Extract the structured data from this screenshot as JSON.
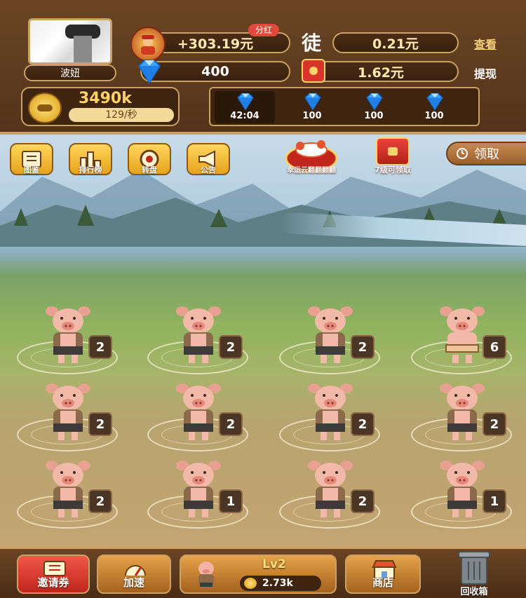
{
  "header": {
    "username": "波妞",
    "earnings": "+303.19元",
    "share_badge": "分红",
    "apprentice_label": "徒",
    "apprentice_amount": "0.21元",
    "view_link": "查看",
    "diamond_count": "400",
    "redpacket_amount": "1.62元",
    "withdraw_link": "提现",
    "coins": "3490k",
    "coin_rate": "129/秒",
    "diamond_slots": [
      {
        "label": "42:04"
      },
      {
        "label": "100"
      },
      {
        "label": "100"
      },
      {
        "label": "100"
      }
    ]
  },
  "scene": {
    "top_buttons": [
      {
        "label": "图鉴",
        "icon": "book-icon"
      },
      {
        "label": "排行榜",
        "icon": "ranking-icon"
      },
      {
        "label": "转盘",
        "icon": "wheel-icon"
      },
      {
        "label": "公告",
        "icon": "megaphone-icon"
      }
    ],
    "lucky_label": "幸运云翻翻翻翻",
    "redpacket_label": "7级可领取",
    "claim_label": "领取",
    "pigs": [
      {
        "level": "2"
      },
      {
        "level": "2"
      },
      {
        "level": "2"
      },
      {
        "level": "6"
      },
      {
        "level": "2"
      },
      {
        "level": "2"
      },
      {
        "level": "2"
      },
      {
        "level": "2"
      },
      {
        "level": "2"
      },
      {
        "level": "1"
      },
      {
        "level": "2"
      },
      {
        "level": "1"
      }
    ]
  },
  "bottom": {
    "invite_label": "邀请券",
    "speed_label": "加速",
    "buy_level": "Lv2",
    "buy_price": "2.73k",
    "shop_label": "商店",
    "recycle_label": "回收箱"
  },
  "colors": {
    "gold": "#caa264",
    "dark_brown": "#4a2c14",
    "diamond_blue": "#2f8ff0",
    "red": "#d9342b"
  }
}
